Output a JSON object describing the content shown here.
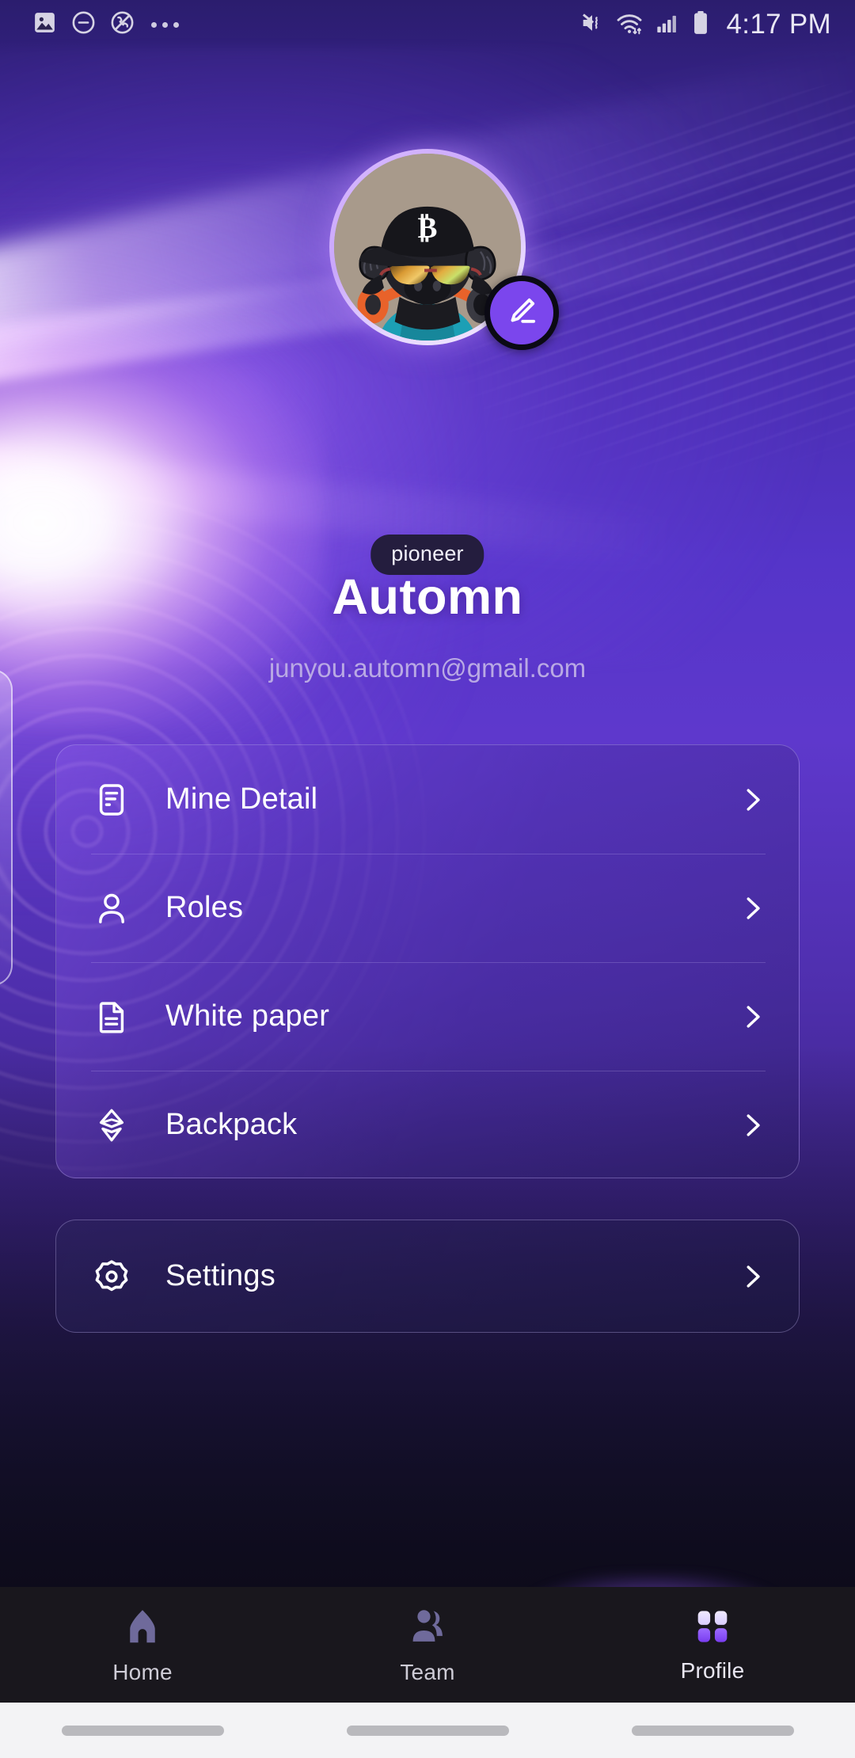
{
  "status_bar": {
    "time": "4:17 PM",
    "left_icons": [
      "image-icon",
      "do-not-disturb-icon",
      "no-call-icon",
      "overflow-dots-icon"
    ],
    "right_icons": [
      "vibrate-mute-icon",
      "wifi-icon",
      "cellular-signal-icon",
      "battery-icon"
    ]
  },
  "profile": {
    "badge": "pioneer",
    "name": "Automn",
    "email": "junyou.automn@gmail.com",
    "avatar_alt": "bull-avatar",
    "edit_icon": "pencil-icon"
  },
  "menu": {
    "primary": [
      {
        "label": "Mine Detail",
        "icon": "mine-detail-icon"
      },
      {
        "label": "Roles",
        "icon": "person-icon"
      },
      {
        "label": "White paper",
        "icon": "document-icon"
      },
      {
        "label": "Backpack",
        "icon": "backpack-diamond-icon"
      }
    ],
    "secondary": [
      {
        "label": "Settings",
        "icon": "gear-icon"
      }
    ],
    "chevron_icon": "chevron-right-icon"
  },
  "bottom_nav": {
    "items": [
      {
        "label": "Home",
        "icon": "home-icon",
        "active": false
      },
      {
        "label": "Team",
        "icon": "team-icon",
        "active": false
      },
      {
        "label": "Profile",
        "icon": "grid-icon",
        "active": true
      }
    ]
  },
  "colors": {
    "accent": "#7b46ed",
    "accent_light": "#a87dff",
    "badge_bg": "#241d3e",
    "nav_bg": "#19171d",
    "nav_inactive": "#6f6a9b",
    "text_primary": "#ffffff",
    "text_muted": "#b9a9e4"
  }
}
